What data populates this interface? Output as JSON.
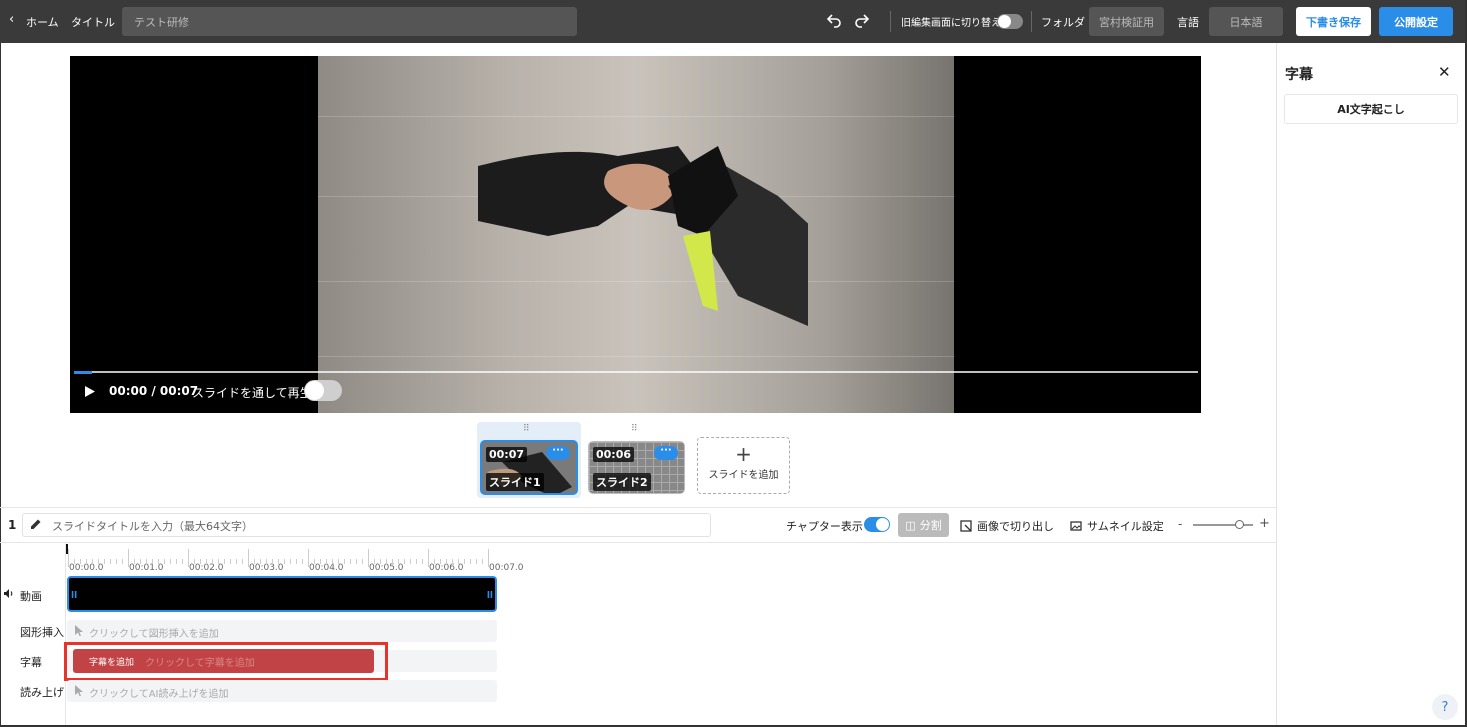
{
  "header": {
    "home": "ホーム",
    "title_label": "タイトル",
    "title_value": "テスト研修",
    "switch_old_editor": "旧編集画面に切り替え",
    "folder_label": "フォルダ",
    "folder_value": "宮村検証用",
    "language_label": "言語",
    "language_value": "日本語",
    "save_draft": "下書き保存",
    "publish_settings": "公開設定",
    "colors": {
      "bg": "#3a3a3a",
      "primary": "#2a8de8"
    }
  },
  "player": {
    "time": "00:00 / 00:07",
    "play_through_label": "スライドを通して再生",
    "play_through_on": false,
    "progress": 0.015
  },
  "slides": [
    {
      "duration": "00:07",
      "name": "スライド1",
      "selected": true
    },
    {
      "duration": "00:06",
      "name": "スライド2",
      "selected": false
    }
  ],
  "add_slide": "スライドを追加",
  "slide_bar": {
    "number": "1",
    "title_placeholder": "スライドタイトルを入力（最大64文字）",
    "chapter_label": "チャプター表示",
    "chapter_on": true,
    "split": "分割",
    "crop_image": "画像で切り出し",
    "thumbnail_settings": "サムネイル設定",
    "zoom_minus": "-",
    "zoom_plus": "+"
  },
  "timeline": {
    "ticks": [
      "00:00.0",
      "00:01.0",
      "00:02.0",
      "00:03.0",
      "00:04.0",
      "00:05.0",
      "00:06.0",
      "00:07.0"
    ],
    "rows": {
      "video": "動画",
      "shape": "図形挿入",
      "subtitle": "字幕",
      "narration": "読み上げ"
    },
    "placeholders": {
      "shape": "クリックして図形挿入を追加",
      "subtitle": "クリックして字幕を追加",
      "narration": "クリックしてAI読み上げを追加"
    },
    "subtitle_add_button": "字幕を追加"
  },
  "right_panel": {
    "title": "字幕",
    "ai_transcribe": "AI文字起こし"
  },
  "help": "?"
}
